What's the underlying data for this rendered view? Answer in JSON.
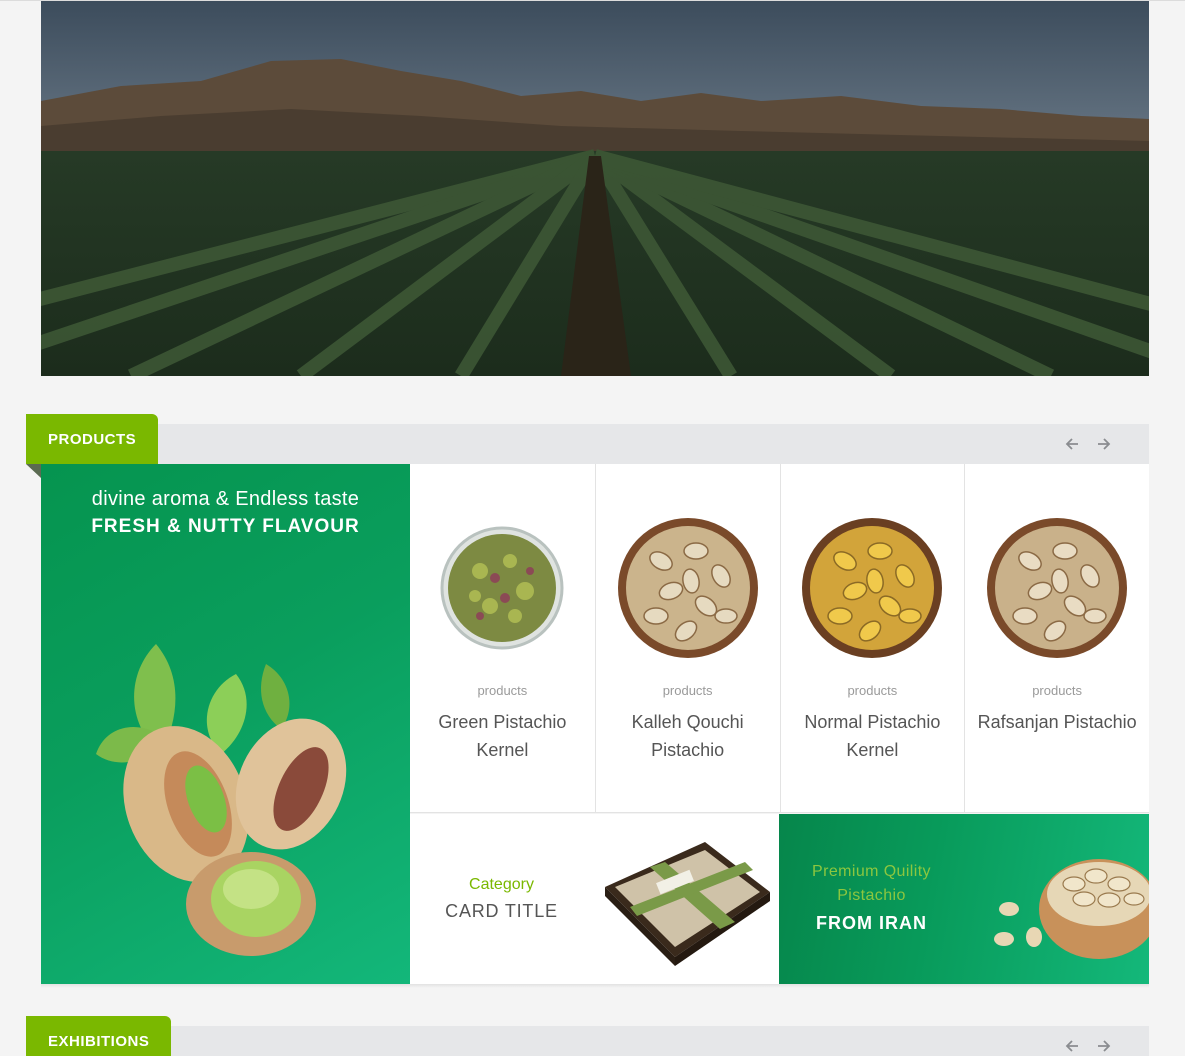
{
  "hero": {
    "image": "pistachio-orchard-mountains"
  },
  "products_section": {
    "tab_label": "PRODUCTS",
    "prev_icon": "arrow-left-icon",
    "next_icon": "arrow-right-icon",
    "promo": {
      "line1": "divine aroma & Endless taste",
      "line2": "FRESH & NUTTY FLAVOUR",
      "image": "pistachio-with-leaves"
    },
    "items": [
      {
        "category": "products",
        "name": "Green Pistachio Kernel",
        "image": "green-kernel-bowl"
      },
      {
        "category": "products",
        "name": "Kalleh Qouchi Pistachio",
        "image": "pistachio-bowl"
      },
      {
        "category": "products",
        "name": "Normal Pistachio Kernel",
        "image": "golden-pistachio-bowl"
      },
      {
        "category": "products",
        "name": "Rafsanjan Pistachio",
        "image": "pistachio-bowl"
      }
    ],
    "card": {
      "category": "Category",
      "title": "CARD TITLE",
      "image": "gift-box"
    },
    "premium": {
      "line1": "Premium Quility",
      "line2": "Pistachio",
      "line3": "FROM IRAN",
      "image": "pistachio-bowl-side"
    }
  },
  "exhibitions_section": {
    "tab_label": "EXHIBITIONS"
  },
  "colors": {
    "accent_green": "#7ab800",
    "promo_green": "#0a9e5d",
    "bar_gray": "#e6e7e9"
  }
}
